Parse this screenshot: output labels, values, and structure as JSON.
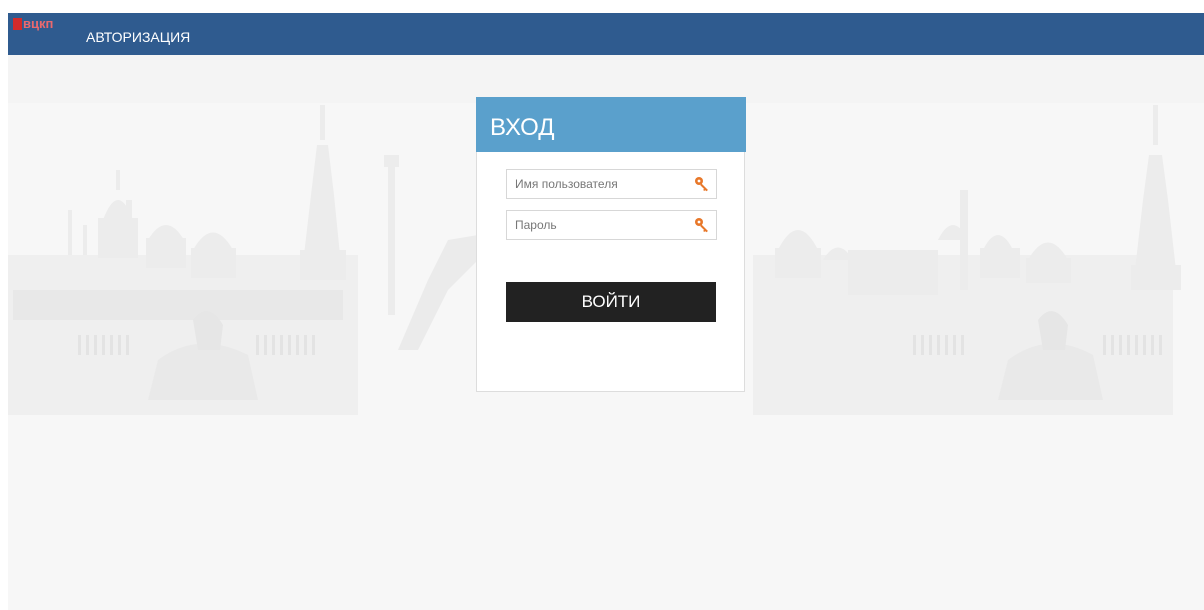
{
  "header": {
    "logo_text": "вцкп",
    "title": "АВТОРИЗАЦИЯ"
  },
  "login": {
    "title": "ВХОД",
    "username": {
      "placeholder": "Имя пользователя",
      "value": ""
    },
    "password": {
      "placeholder": "Пароль",
      "value": ""
    },
    "submit_label": "ВОЙТИ"
  },
  "icons": {
    "logo": "vckp-logo",
    "field_icon": "key-icon",
    "background": "city-skyline-illustration"
  },
  "colors": {
    "topbar": "#2f5b8f",
    "login_header": "#5aa0cc",
    "submit_button": "#222222",
    "key_icon": "#e8782a",
    "logo_red": "#d22b2b"
  }
}
